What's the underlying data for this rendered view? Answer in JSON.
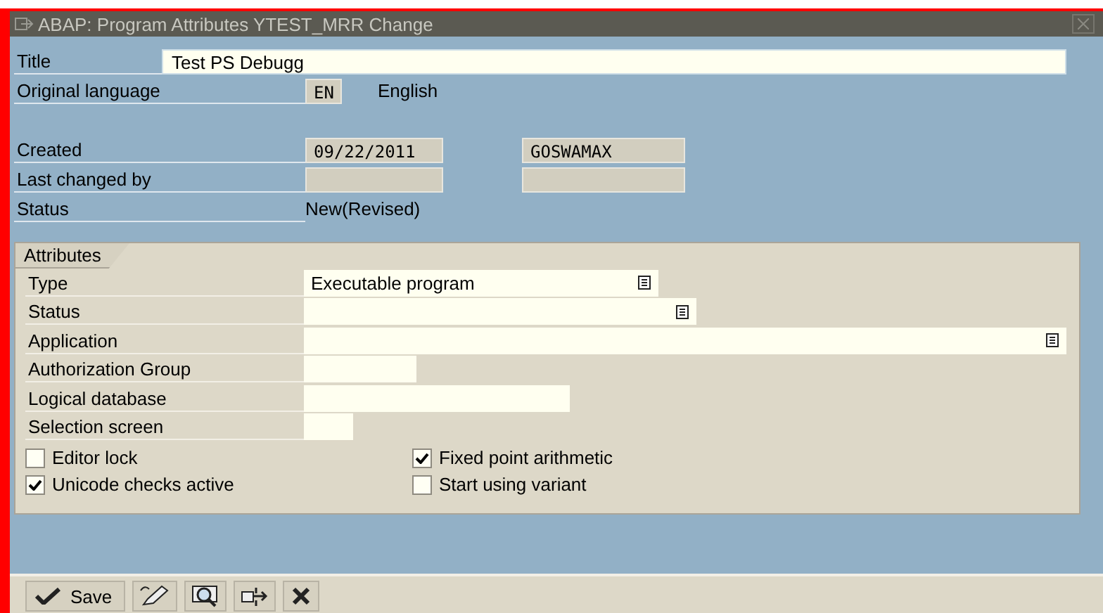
{
  "window": {
    "title": "ABAP: Program Attributes YTEST_MRR Change"
  },
  "header": {
    "title": {
      "label": "Title",
      "value": "Test PS Debugg"
    },
    "language": {
      "label": "Original language",
      "code": "EN",
      "name": "English"
    },
    "created": {
      "label": "Created",
      "date": "09/22/2011",
      "user": "GOSWAMAX"
    },
    "last_changed": {
      "label": "Last changed by"
    },
    "status": {
      "label": "Status",
      "value": "New(Revised)"
    }
  },
  "attributes": {
    "tab": "Attributes",
    "fields": [
      {
        "label": "Type",
        "value": "Executable program",
        "kind": "dropdown"
      },
      {
        "label": "Status",
        "kind": "dropdown"
      },
      {
        "label": "Application",
        "kind": "dropdown"
      },
      {
        "label": "Authorization Group",
        "kind": "input"
      },
      {
        "label": "Logical database",
        "kind": "input"
      },
      {
        "label": "Selection screen",
        "kind": "input"
      }
    ],
    "checkboxes": [
      {
        "label": "Editor lock",
        "checked": false
      },
      {
        "label": "Fixed point arithmetic",
        "checked": true
      },
      {
        "label": "Unicode checks active",
        "checked": true
      },
      {
        "label": "Start using variant",
        "checked": false
      }
    ]
  },
  "toolbar": [
    {
      "kind": "save",
      "label": "Save"
    },
    {
      "kind": "edit"
    },
    {
      "kind": "find"
    },
    {
      "kind": "transfer"
    },
    {
      "kind": "cancel"
    }
  ]
}
